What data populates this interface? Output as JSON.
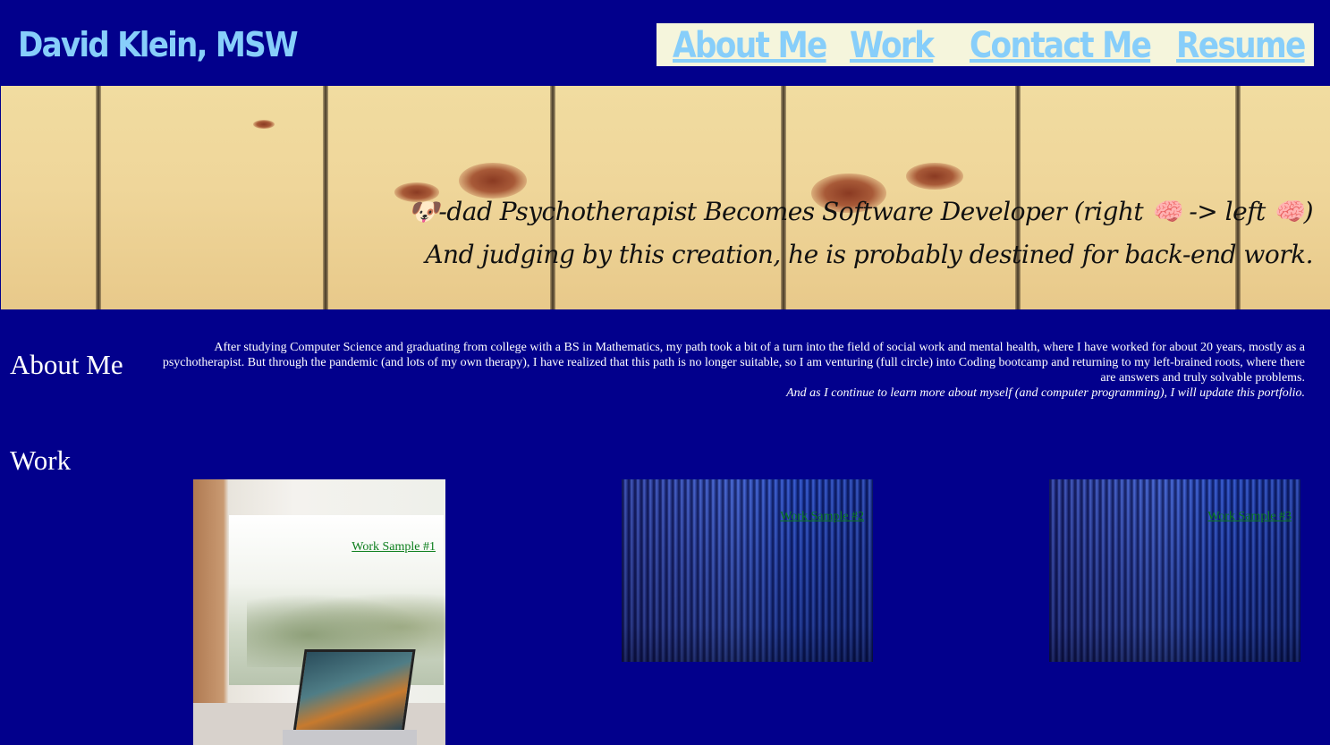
{
  "header": {
    "site_title": "David Klein, MSW",
    "nav": [
      "About Me",
      "Work",
      "Contact Me",
      "Resume"
    ]
  },
  "hero": {
    "line1": "🐶-dad Psychotherapist Becomes Software Developer (right 🧠 -> left 🧠)",
    "line2": "And judging by this creation, he is probably destined for back-end work."
  },
  "about": {
    "title": "About Me",
    "paragraph": "After studying Computer Science and graduating from college with a BS in Mathematics, my path took a bit of a turn into the field of social work and mental health, where I have worked for about 20 years, mostly as a psychotherapist. But through the pandemic (and lots of my own therapy), I have realized that this path is no longer suitable, so I am venturing (full circle) into Coding bootcamp and returning to my left-brained roots, where there are answers and truly solvable problems.",
    "italic": "And as I continue to learn more about myself (and computer programming), I will update this portfolio."
  },
  "work": {
    "title": "Work",
    "samples": [
      "Work Sample #1",
      "Work Sample #2",
      "Work Sample #3"
    ]
  },
  "colors": {
    "background": "#02008c",
    "title": "#87cefa",
    "nav_bg": "#f5f5dc",
    "link": "#0a7d1a"
  }
}
